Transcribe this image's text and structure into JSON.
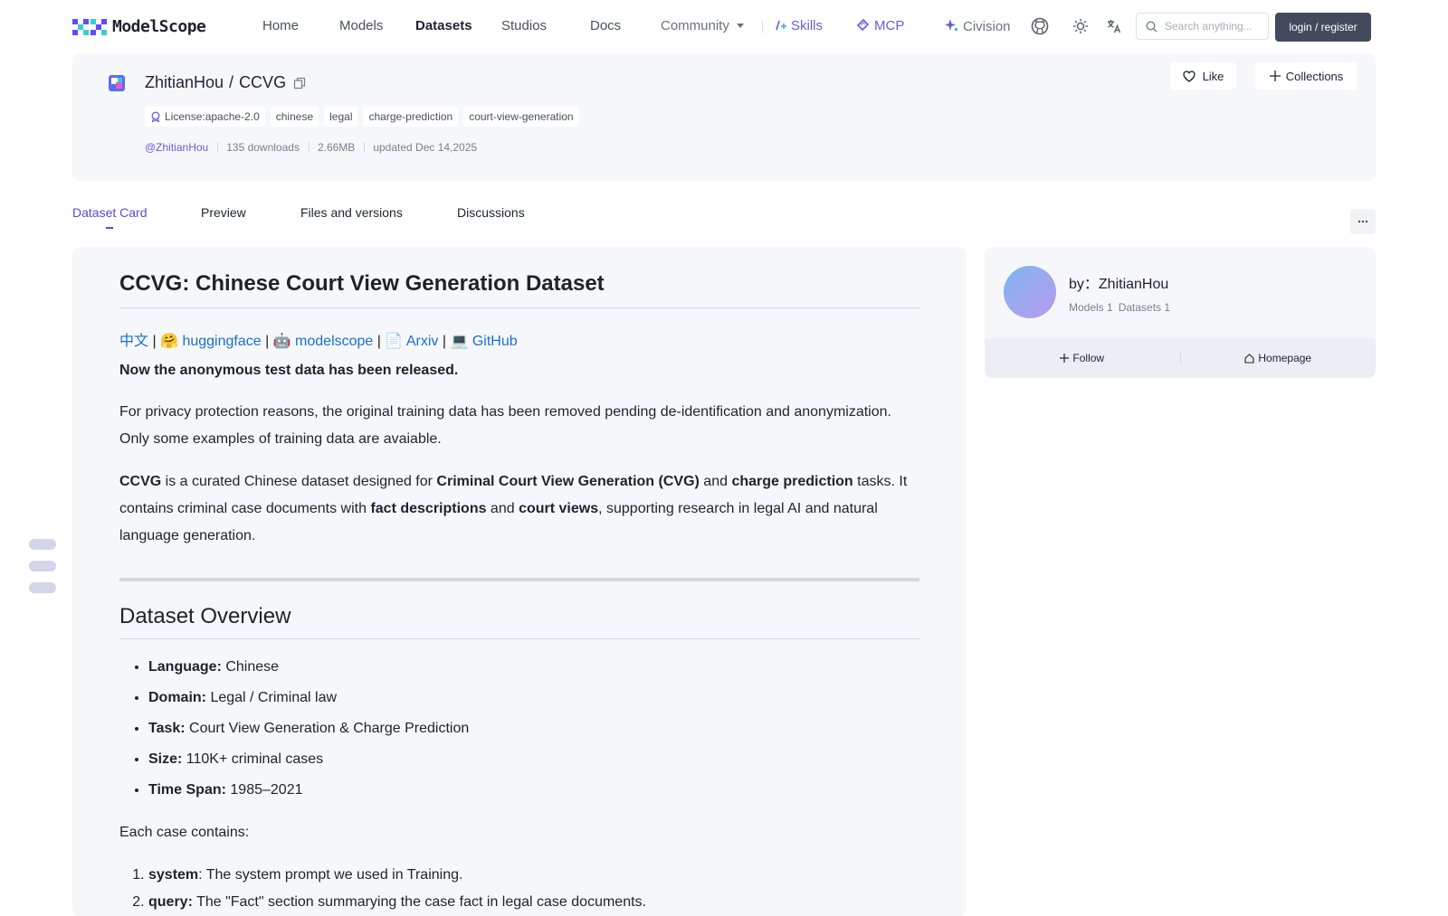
{
  "nav": {
    "logo_text": "ModelScope",
    "items": [
      "Home",
      "Models",
      "Datasets",
      "Studios",
      "Docs"
    ],
    "community": "Community",
    "skills": "Skills",
    "mcp": "MCP",
    "civision": "Civision",
    "search_placeholder": "Search anything...",
    "login": "login / register"
  },
  "dataset": {
    "owner": "ZhitianHou",
    "slash": "/",
    "name": "CCVG",
    "license": "License:apache-2.0",
    "tags": [
      "chinese",
      "legal",
      "charge-prediction",
      "court-view-generation"
    ],
    "author_handle": "@ZhitianHou",
    "downloads": "135 downloads",
    "size": "2.66MB",
    "updated": "updated Dec 14,2025",
    "like": "Like",
    "collections": "Collections"
  },
  "tabs": [
    "Dataset Card",
    "Preview",
    "Files and versions",
    "Discussions"
  ],
  "card": {
    "title": "CCVG: Chinese Court View Generation Dataset",
    "links": {
      "zh": "中文",
      "hf_emoji": "🤗",
      "hf": "huggingface",
      "ms_emoji": "🤖",
      "ms": "modelscope",
      "arxiv_emoji": "📄",
      "arxiv": "Arxiv",
      "gh_emoji": "💻",
      "gh": "GitHub",
      "bar": " | "
    },
    "release_note": "Now the anonymous test data has been released.",
    "privacy": "For privacy protection reasons, the original training data has been removed pending de-identification and anonymization. Only some examples of training data are avaiable.",
    "desc": {
      "ccvg": "CCVG",
      "t1": " is a curated Chinese dataset designed for ",
      "cvg": "Criminal Court View Generation (CVG)",
      "t2": " and ",
      "cp": "charge prediction",
      "t3": " tasks. It contains criminal case documents with ",
      "fd": "fact descriptions",
      "t4": " and ",
      "cv": "court views",
      "t5": ", supporting research in legal AI and natural language generation."
    },
    "overview_title": "Dataset Overview",
    "facts": [
      {
        "k": "Language:",
        "v": " Chinese"
      },
      {
        "k": "Domain:",
        "v": " Legal / Criminal law"
      },
      {
        "k": "Task:",
        "v": " Court View Generation & Charge Prediction"
      },
      {
        "k": "Size:",
        "v": " 110K+ criminal cases"
      },
      {
        "k": "Time Span:",
        "v": " 1985–2021"
      }
    ],
    "each_case": "Each case contains:",
    "fields": [
      {
        "k": "system",
        "v": ": The system prompt we used in Training."
      },
      {
        "k": "query:",
        "v": " The \"Fact\" section summarying the case fact in legal case documents."
      }
    ]
  },
  "author": {
    "name": "by：ZhitianHou",
    "models": "Models 1",
    "datasets": "Datasets 1",
    "follow": "Follow",
    "homepage": "Homepage"
  },
  "colors": {
    "accent": "#5a4bd1",
    "link": "#1a6fd1",
    "card_bg": "#f6f7fb",
    "login_bg": "#434a5e"
  }
}
